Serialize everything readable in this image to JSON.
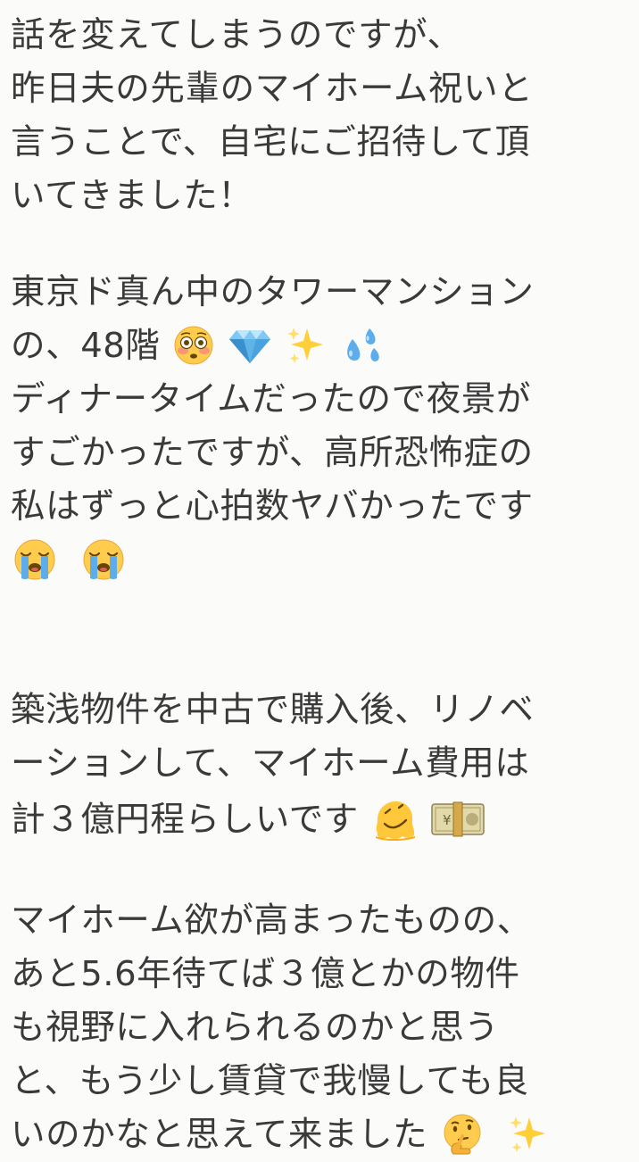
{
  "post": {
    "paragraphs": [
      {
        "lines": [
          {
            "text": "話を変えてしまうのですが、"
          },
          {
            "text": "昨日夫の先輩のマイホーム祝いと"
          },
          {
            "text": "言うことで、自宅にご招待して頂"
          },
          {
            "text": "いてきました！"
          }
        ]
      },
      {
        "lines": [
          {
            "text": "東京ド真ん中のタワーマンション"
          },
          {
            "text": "の、48階",
            "emojis": [
              "flushed-face-emoji",
              "gem-emoji",
              "sparkles-emoji",
              "sweat-droplets-emoji"
            ]
          },
          {
            "text": "ディナータイムだったので夜景が"
          },
          {
            "text": "すごかったですが、高所恐怖症の"
          },
          {
            "text": "私はずっと心拍数ヤバかったです"
          },
          {
            "text": "",
            "emojis": [
              "crying-face-emoji",
              "crying-face-emoji"
            ]
          }
        ]
      },
      {
        "lines": [
          {
            "text": "築浅物件を中古で購入後、リノベ"
          },
          {
            "text": "ーションして、マイホーム費用は"
          },
          {
            "text": "計３億円程らしいです",
            "emojis": [
              "melting-face-emoji",
              "banknote-emoji"
            ]
          }
        ]
      },
      {
        "lines": [
          {
            "text": "マイホーム欲が高まったものの、"
          },
          {
            "text": "あと5.6年待てば３億とかの物件"
          },
          {
            "text": "も視野に入れられるのかと思う"
          },
          {
            "text": "と、もう少し賃貸で我慢しても良"
          },
          {
            "text": "いのかなと思えて来ました",
            "emojis": [
              "thinking-face-emoji",
              "sparkles-emoji"
            ]
          }
        ]
      }
    ]
  }
}
